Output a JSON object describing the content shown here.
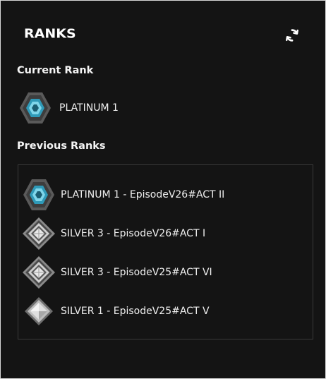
{
  "header": {
    "logo_text": "RANKS",
    "refresh_icon": "refresh-icon"
  },
  "current": {
    "title": "Current Rank",
    "rank": {
      "label": "PLATINUM 1",
      "tier": "platinum",
      "icon": "platinum-rank-icon"
    }
  },
  "previous": {
    "title": "Previous Ranks",
    "items": [
      {
        "label": "PLATINUM 1 - EpisodeV26#ACT II",
        "tier": "platinum",
        "icon": "platinum-rank-icon"
      },
      {
        "label": "SILVER 3 - EpisodeV26#ACT I",
        "tier": "silver3",
        "icon": "silver-rank-icon"
      },
      {
        "label": "SILVER 3 - EpisodeV25#ACT VI",
        "tier": "silver3",
        "icon": "silver-rank-icon"
      },
      {
        "label": "SILVER 1 - EpisodeV25#ACT V",
        "tier": "silver1",
        "icon": "silver-rank-icon"
      }
    ]
  },
  "colors": {
    "background": "#141414",
    "platinum_teal": "#3aa9c4",
    "silver": "#bfbfbf"
  }
}
